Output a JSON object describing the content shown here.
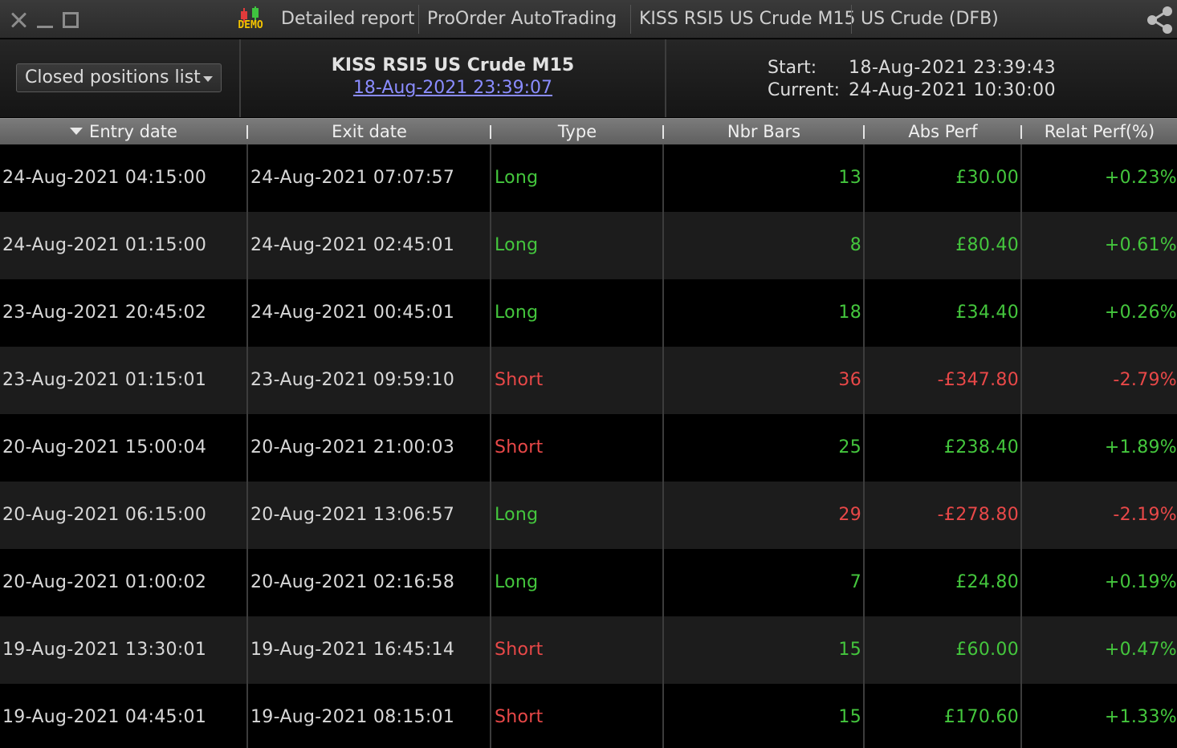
{
  "titlebar": {
    "demo_label": "DEMO",
    "tabs": [
      "Detailed report",
      "ProOrder AutoTrading",
      "KISS RSI5 US Crude M15",
      "US Crude (DFB)"
    ]
  },
  "header": {
    "view_select": "Closed positions list",
    "strategy_name": "KISS RSI5 US Crude M15",
    "strategy_date": "18-Aug-2021 23:39:07",
    "start_label": "Start:",
    "start_value": "18-Aug-2021 23:39:43",
    "current_label": "Current:",
    "current_value": "24-Aug-2021 10:30:00"
  },
  "columns": [
    "Entry date",
    "Exit date",
    "Type",
    "Nbr Bars",
    "Abs Perf",
    "Relat Perf(%)"
  ],
  "rows": [
    {
      "entry": "24-Aug-2021 04:15:00",
      "exit": "24-Aug-2021 07:07:57",
      "type": "Long",
      "bars": "13",
      "abs": "£30.00",
      "rel": "+0.23%",
      "positive": true
    },
    {
      "entry": "24-Aug-2021 01:15:00",
      "exit": "24-Aug-2021 02:45:01",
      "type": "Long",
      "bars": "8",
      "abs": "£80.40",
      "rel": "+0.61%",
      "positive": true
    },
    {
      "entry": "23-Aug-2021 20:45:02",
      "exit": "24-Aug-2021 00:45:01",
      "type": "Long",
      "bars": "18",
      "abs": "£34.40",
      "rel": "+0.26%",
      "positive": true
    },
    {
      "entry": "23-Aug-2021 01:15:01",
      "exit": "23-Aug-2021 09:59:10",
      "type": "Short",
      "bars": "36",
      "abs": "-£347.80",
      "rel": "-2.79%",
      "positive": false
    },
    {
      "entry": "20-Aug-2021 15:00:04",
      "exit": "20-Aug-2021 21:00:03",
      "type": "Short",
      "bars": "25",
      "abs": "£238.40",
      "rel": "+1.89%",
      "positive": true
    },
    {
      "entry": "20-Aug-2021 06:15:00",
      "exit": "20-Aug-2021 13:06:57",
      "type": "Long",
      "bars": "29",
      "abs": "-£278.80",
      "rel": "-2.19%",
      "positive": false
    },
    {
      "entry": "20-Aug-2021 01:00:02",
      "exit": "20-Aug-2021 02:16:58",
      "type": "Long",
      "bars": "7",
      "abs": "£24.80",
      "rel": "+0.19%",
      "positive": true
    },
    {
      "entry": "19-Aug-2021 13:30:01",
      "exit": "19-Aug-2021 16:45:14",
      "type": "Short",
      "bars": "15",
      "abs": "£60.00",
      "rel": "+0.47%",
      "positive": true
    },
    {
      "entry": "19-Aug-2021 04:45:01",
      "exit": "19-Aug-2021 08:15:01",
      "type": "Short",
      "bars": "15",
      "abs": "£170.60",
      "rel": "+1.33%",
      "positive": true
    }
  ],
  "colors": {
    "long": "#44c63d",
    "short": "#e84848",
    "positive": "#44c63d",
    "negative": "#e84848",
    "link": "#8a8cff"
  }
}
